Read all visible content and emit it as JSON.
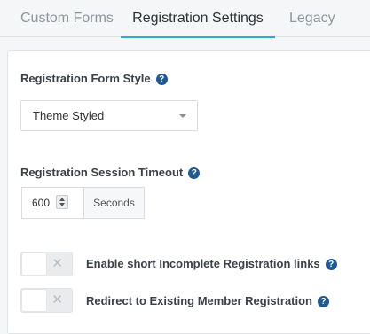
{
  "tabs": [
    {
      "label": "Custom Forms"
    },
    {
      "label": "Registration Settings",
      "active": true
    },
    {
      "label": "Legacy"
    }
  ],
  "form_style": {
    "label": "Registration Form Style",
    "help_icon": "question-circle-icon",
    "selected": "Theme Styled"
  },
  "session_timeout": {
    "label": "Registration Session Timeout",
    "help_icon": "question-circle-icon",
    "value": "600",
    "unit": "Seconds"
  },
  "toggles": [
    {
      "label": "Enable short Incomplete Registration links",
      "state": "off",
      "help_icon": "question-circle-icon"
    },
    {
      "label": "Redirect to Existing Member Registration",
      "state": "off",
      "help_icon": "question-circle-icon"
    }
  ],
  "colors": {
    "active_tab_underline": "#36a9c9",
    "help_icon": "#1f5a96"
  }
}
